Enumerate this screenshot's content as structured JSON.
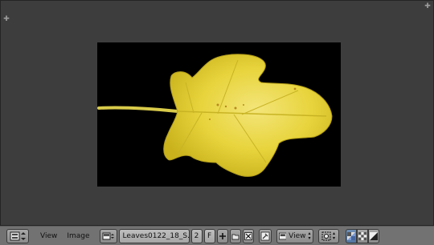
{
  "menus": {
    "view": "View",
    "image": "Image"
  },
  "image_block": {
    "name": "Leaves0122_18_S...",
    "users": "2",
    "fake_user": "F"
  },
  "view_mode": {
    "label": "View"
  },
  "icons": {
    "editor_type": "image-editor-icon",
    "browse_image": "image-browse-icon",
    "new_image": "plus-icon",
    "open_image": "folder-icon",
    "unlink_image": "x-icon",
    "pin": "pin-icon",
    "mode": "view-mode-icon",
    "pivot": "pivot-icon",
    "draw_rgb_alpha": "rgb-alpha-icon",
    "draw_alpha": "alpha-icon",
    "draw_z": "z-buffer-icon"
  }
}
